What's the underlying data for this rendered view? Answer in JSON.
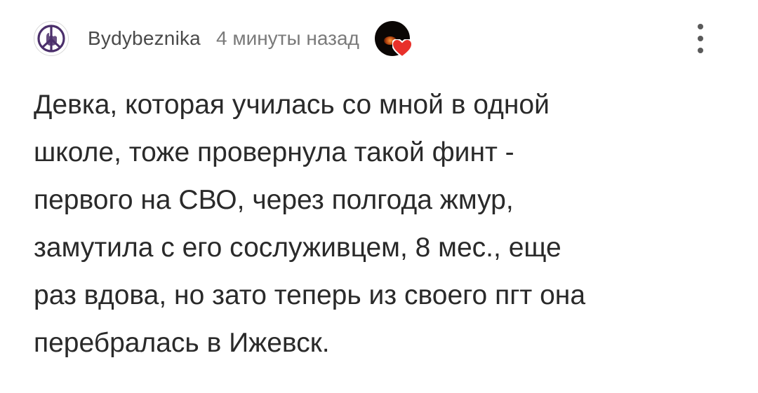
{
  "comment": {
    "author": "Bydybeznika",
    "timestamp": "4 минуты назад",
    "avatar_icon": "peace-hand-icon",
    "badge_icon": "heart-badge-icon",
    "menu_icon": "more-vertical-icon",
    "text_lines": [
      "Девка, которая училась со мной в одной",
      "школе, тоже провернула такой финт -",
      "первого на СВО, через полгода жмур,",
      "замутила с его сослуживцем, 8 мес., еще",
      "раз вдова, но зато теперь из своего пгт она",
      "перебралась в Ижевск."
    ]
  },
  "colors": {
    "avatar_stroke": "#4b2f6b",
    "heart": "#e8302a",
    "badge_bg": "#0b0705",
    "text": "#2a2a2a",
    "muted": "#7a7a7a"
  }
}
